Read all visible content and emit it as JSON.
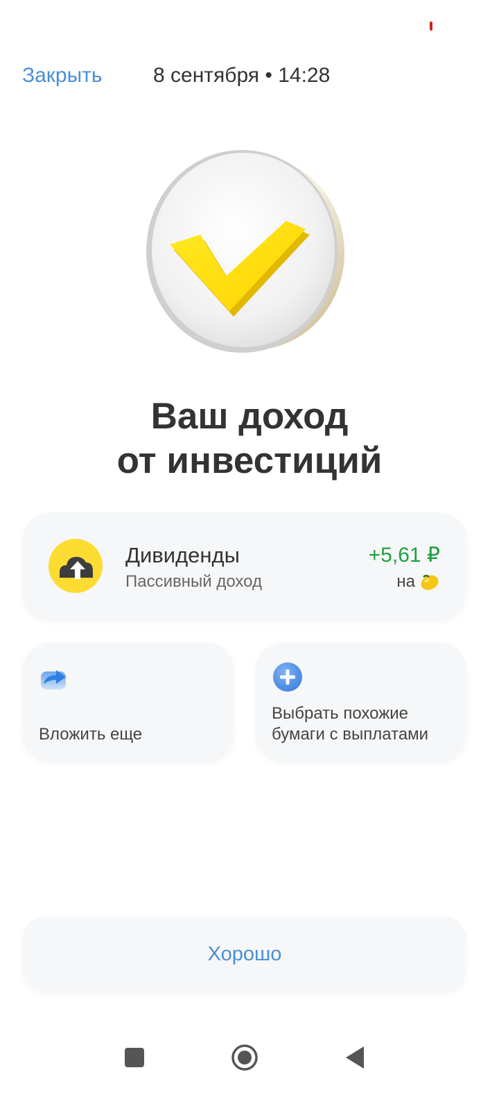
{
  "header": {
    "close_label": "Закрыть",
    "date_time": "8 сентября • 14:28"
  },
  "hero": {
    "icon": "yellow-checkmark-coin"
  },
  "title": {
    "line1": "Ваш доход",
    "line2": "от инвестиций"
  },
  "dividend": {
    "title": "Дивиденды",
    "subtitle": "Пассивный доход",
    "amount": "+5,61 ₽",
    "on_label": "на",
    "icon": "cloud-arrow-up-icon",
    "target_icon": "lemon-icon",
    "amount_color": "#1fa13f"
  },
  "actions": [
    {
      "label": "Вложить еще",
      "icon": "share-arrow-icon"
    },
    {
      "label": "Выбрать похожие бумаги с выплатами",
      "icon": "plus-circle-icon"
    }
  ],
  "ok_button": {
    "label": "Хорошо"
  },
  "colors": {
    "accent": "#4a8fd6",
    "card_bg": "#f6f7f8",
    "yellow": "#fddc32",
    "positive": "#1fa13f"
  }
}
